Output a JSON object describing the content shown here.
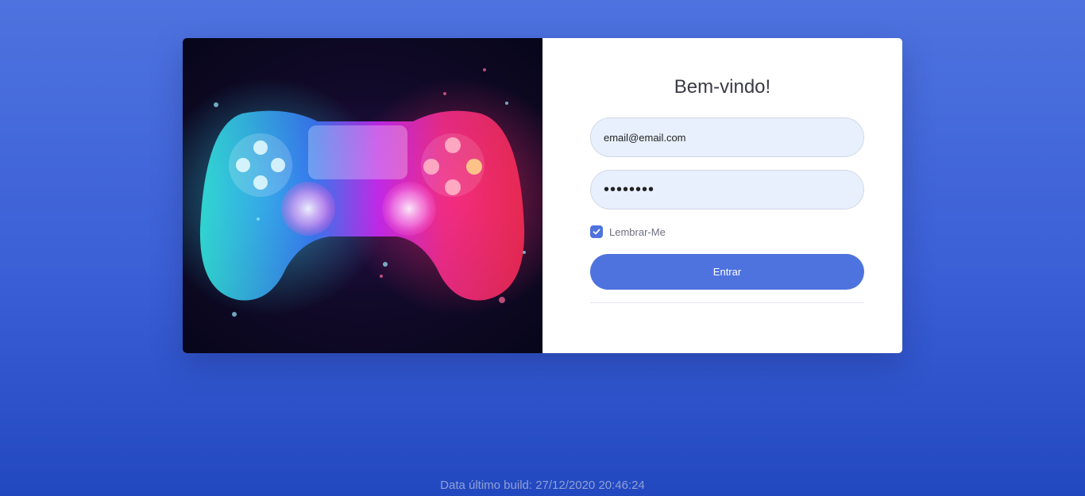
{
  "login": {
    "title": "Bem-vindo!",
    "email_value": "email@email.com",
    "password_value": "••••••••",
    "remember_label": "Lembrar-Me",
    "remember_checked": true,
    "submit_label": "Entrar"
  },
  "footer": {
    "build_text": "Data último build: 27/12/2020 20:46:24"
  },
  "colors": {
    "primary": "#4e73df",
    "input_bg": "#e8f0fe"
  }
}
